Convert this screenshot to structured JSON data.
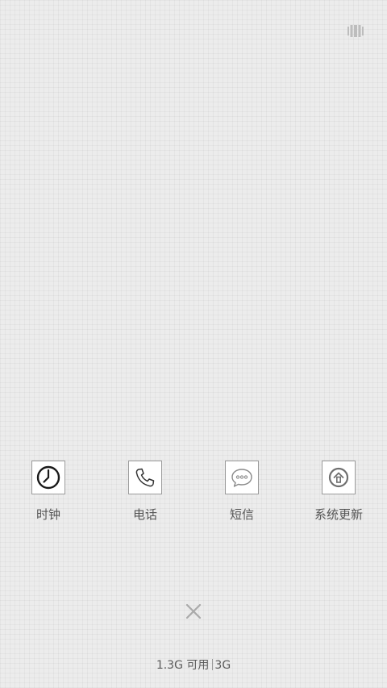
{
  "top_right": {
    "icon": "recents-view-toggle-icon"
  },
  "apps": [
    {
      "label": "时钟",
      "icon": "clock-icon"
    },
    {
      "label": "电话",
      "icon": "phone-icon"
    },
    {
      "label": "短信",
      "icon": "message-icon"
    },
    {
      "label": "系统更新",
      "icon": "system-update-icon"
    }
  ],
  "close_all": {
    "icon": "close-icon"
  },
  "memory": {
    "available": "1.3G 可用",
    "total": "3G"
  },
  "colors": {
    "background": "#ececec",
    "icon_border": "#9a9a9a",
    "label_text": "#555555",
    "close_x": "#aaaaaa"
  }
}
